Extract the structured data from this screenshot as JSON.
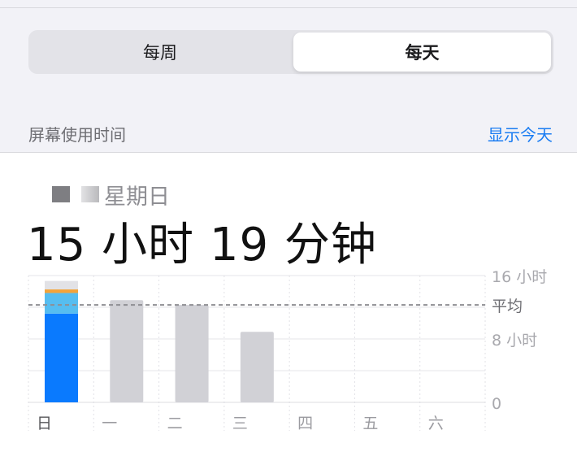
{
  "segmented": {
    "weekly": "每周",
    "daily": "每天",
    "selected": "daily"
  },
  "section": {
    "label": "屏幕使用时间",
    "action": "显示今天"
  },
  "summary": {
    "day": "星期日",
    "total": "15 小时 19 分钟"
  },
  "colors": {
    "accent": "#1a7cf2",
    "blue": "#0a7afe",
    "light_blue": "#56bdf0",
    "orange": "#f3a33a",
    "gray_bar": "#d1d1d6"
  },
  "chart_data": {
    "type": "bar",
    "categories": [
      "日",
      "一",
      "二",
      "三",
      "四",
      "五",
      "六"
    ],
    "ylim": [
      0,
      16
    ],
    "y_tick_labels": [
      "16 小时",
      "8 小时",
      "0"
    ],
    "y_ticks": [
      16,
      8,
      0
    ],
    "average": 12.3,
    "average_label": "平均",
    "today_index": 0,
    "totals": [
      15.32,
      12.9,
      12.3,
      8.9,
      0,
      0,
      0
    ],
    "today_stack": [
      {
        "name": "blue",
        "value": 11.2
      },
      {
        "name": "light_blue",
        "value": 2.6
      },
      {
        "name": "orange",
        "value": 0.45
      },
      {
        "name": "other",
        "value": 1.07
      }
    ]
  }
}
